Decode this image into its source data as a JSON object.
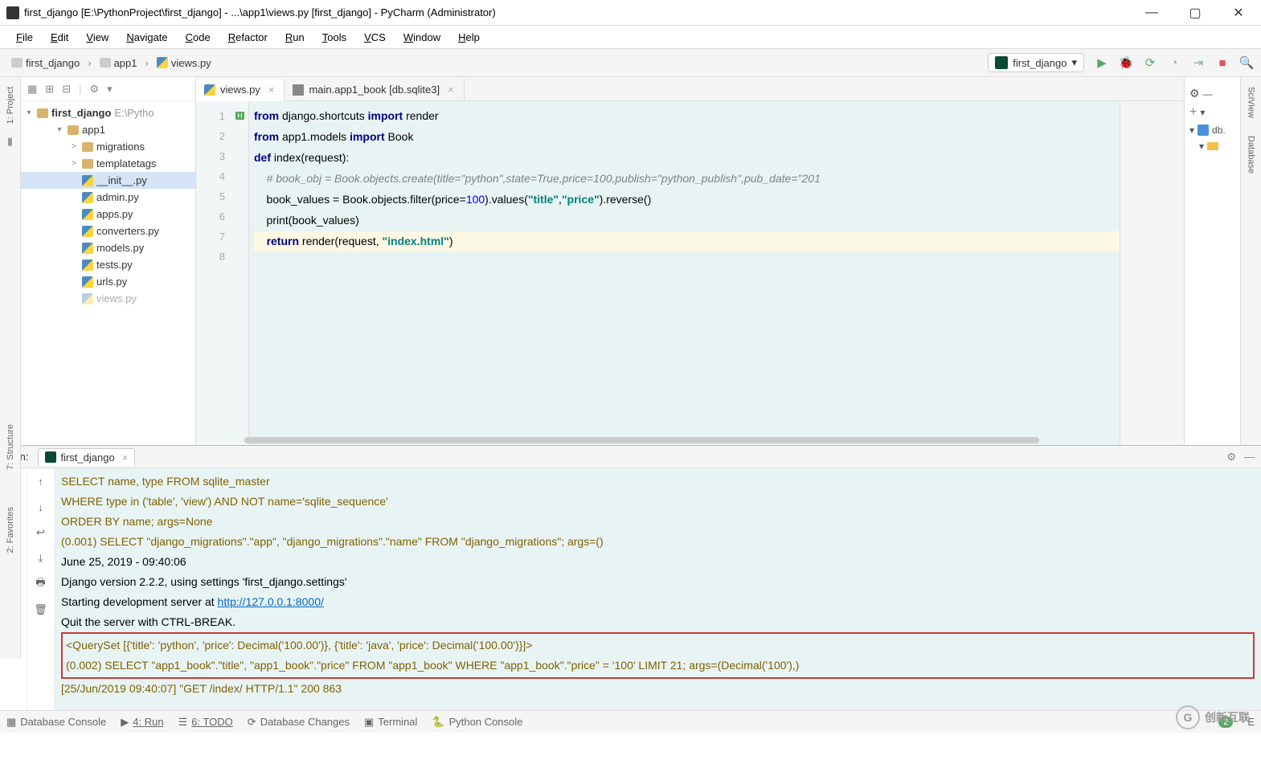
{
  "title": "first_django [E:\\PythonProject\\first_django] - ...\\app1\\views.py [first_django] - PyCharm (Administrator)",
  "menu": [
    "File",
    "Edit",
    "View",
    "Navigate",
    "Code",
    "Refactor",
    "Run",
    "Tools",
    "VCS",
    "Window",
    "Help"
  ],
  "breadcrumb": [
    "first_django",
    "app1",
    "views.py"
  ],
  "run_config": "first_django",
  "project": {
    "root": "first_django",
    "root_path": "E:\\Pytho",
    "items": [
      {
        "name": "app1",
        "type": "folder",
        "expanded": true,
        "level": 1
      },
      {
        "name": "migrations",
        "type": "folder",
        "expanded": false,
        "level": 2,
        "chev": ">"
      },
      {
        "name": "templatetags",
        "type": "folder",
        "expanded": false,
        "level": 2,
        "chev": ">"
      },
      {
        "name": "__init__.py",
        "type": "py",
        "level": 2,
        "selected": true
      },
      {
        "name": "admin.py",
        "type": "py",
        "level": 2
      },
      {
        "name": "apps.py",
        "type": "py",
        "level": 2
      },
      {
        "name": "converters.py",
        "type": "py",
        "level": 2
      },
      {
        "name": "models.py",
        "type": "py",
        "level": 2
      },
      {
        "name": "tests.py",
        "type": "py",
        "level": 2
      },
      {
        "name": "urls.py",
        "type": "py",
        "level": 2
      },
      {
        "name": "views.py",
        "type": "py",
        "level": 2,
        "cut": true
      }
    ]
  },
  "editor_tabs": [
    {
      "label": "views.py",
      "icon": "py",
      "active": true
    },
    {
      "label": "main.app1_book [db.sqlite3]",
      "icon": "table",
      "active": false
    }
  ],
  "code_lines": [
    {
      "n": 1,
      "html": "<span class='kw'>from</span> django.shortcuts <span class='kw'>import</span> render"
    },
    {
      "n": 2,
      "html": "<span class='kw'>from</span> app1.models <span class='kw'>import</span> Book"
    },
    {
      "n": 3,
      "html": "<span class='kw'>def</span> <span class='fn'>index</span>(request):"
    },
    {
      "n": 4,
      "html": "    <span class='cmt'># book_obj = Book.objects.create(title=\"python\",state=True,price=100,publish=\"python_publish\",pub_date=\"201</span>"
    },
    {
      "n": 5,
      "html": "    book_values = Book.objects.filter(price=<span class='num'>100</span>).values(<span class='str'>\"title\"</span>,<span class='str'>\"price\"</span>).reverse()"
    },
    {
      "n": 6,
      "html": "    print(book_values)"
    },
    {
      "n": 7,
      "html": "    <span class='kw'>return</span> render(request, <span class='str'>\"index.html\"</span>)",
      "hl": true,
      "marker": "H"
    },
    {
      "n": 8,
      "html": "",
      "hl": true
    }
  ],
  "run_label": "Run:",
  "run_tab": "first_django",
  "console_lines": [
    {
      "cls": "brown",
      "text": "            SELECT name, type FROM sqlite_master"
    },
    {
      "cls": "brown",
      "text": "            WHERE type in ('table', 'view') AND NOT name='sqlite_sequence'"
    },
    {
      "cls": "brown",
      "text": "            ORDER BY name; args=None"
    },
    {
      "cls": "brown",
      "text": "(0.001) SELECT \"django_migrations\".\"app\", \"django_migrations\".\"name\" FROM \"django_migrations\"; args=()"
    },
    {
      "cls": "",
      "text": "June 25, 2019 - 09:40:06"
    },
    {
      "cls": "",
      "text": "Django version 2.2.2, using settings 'first_django.settings'"
    },
    {
      "cls": "",
      "html": "Starting development server at <span class='link'>http://127.0.0.1:8000/</span>"
    },
    {
      "cls": "",
      "text": "Quit the server with CTRL-BREAK."
    }
  ],
  "console_boxed": [
    "<QuerySet [{'title': 'python', 'price': Decimal('100.00')}, {'title': 'java', 'price': Decimal('100.00')}]>",
    "(0.002) SELECT \"app1_book\".\"title\", \"app1_book\".\"price\" FROM \"app1_book\" WHERE \"app1_book\".\"price\" = '100'  LIMIT 21; args=(Decimal('100'),)"
  ],
  "console_after": "[25/Jun/2019 09:40:07] \"GET /index/ HTTP/1.1\" 200 863",
  "statusbar": {
    "items": [
      "Database Console",
      "4: Run",
      "6: TODO",
      "Database Changes",
      "Terminal",
      "Python Console"
    ],
    "badge": "2",
    "ev": "E"
  },
  "left_tabs": [
    "1: Project"
  ],
  "left_tabs2": [
    "7: Structure",
    "2: Favorites"
  ],
  "right_tabs": [
    "SciView",
    "Database"
  ],
  "db_panel": {
    "node": "db."
  },
  "watermark": "创新互联"
}
